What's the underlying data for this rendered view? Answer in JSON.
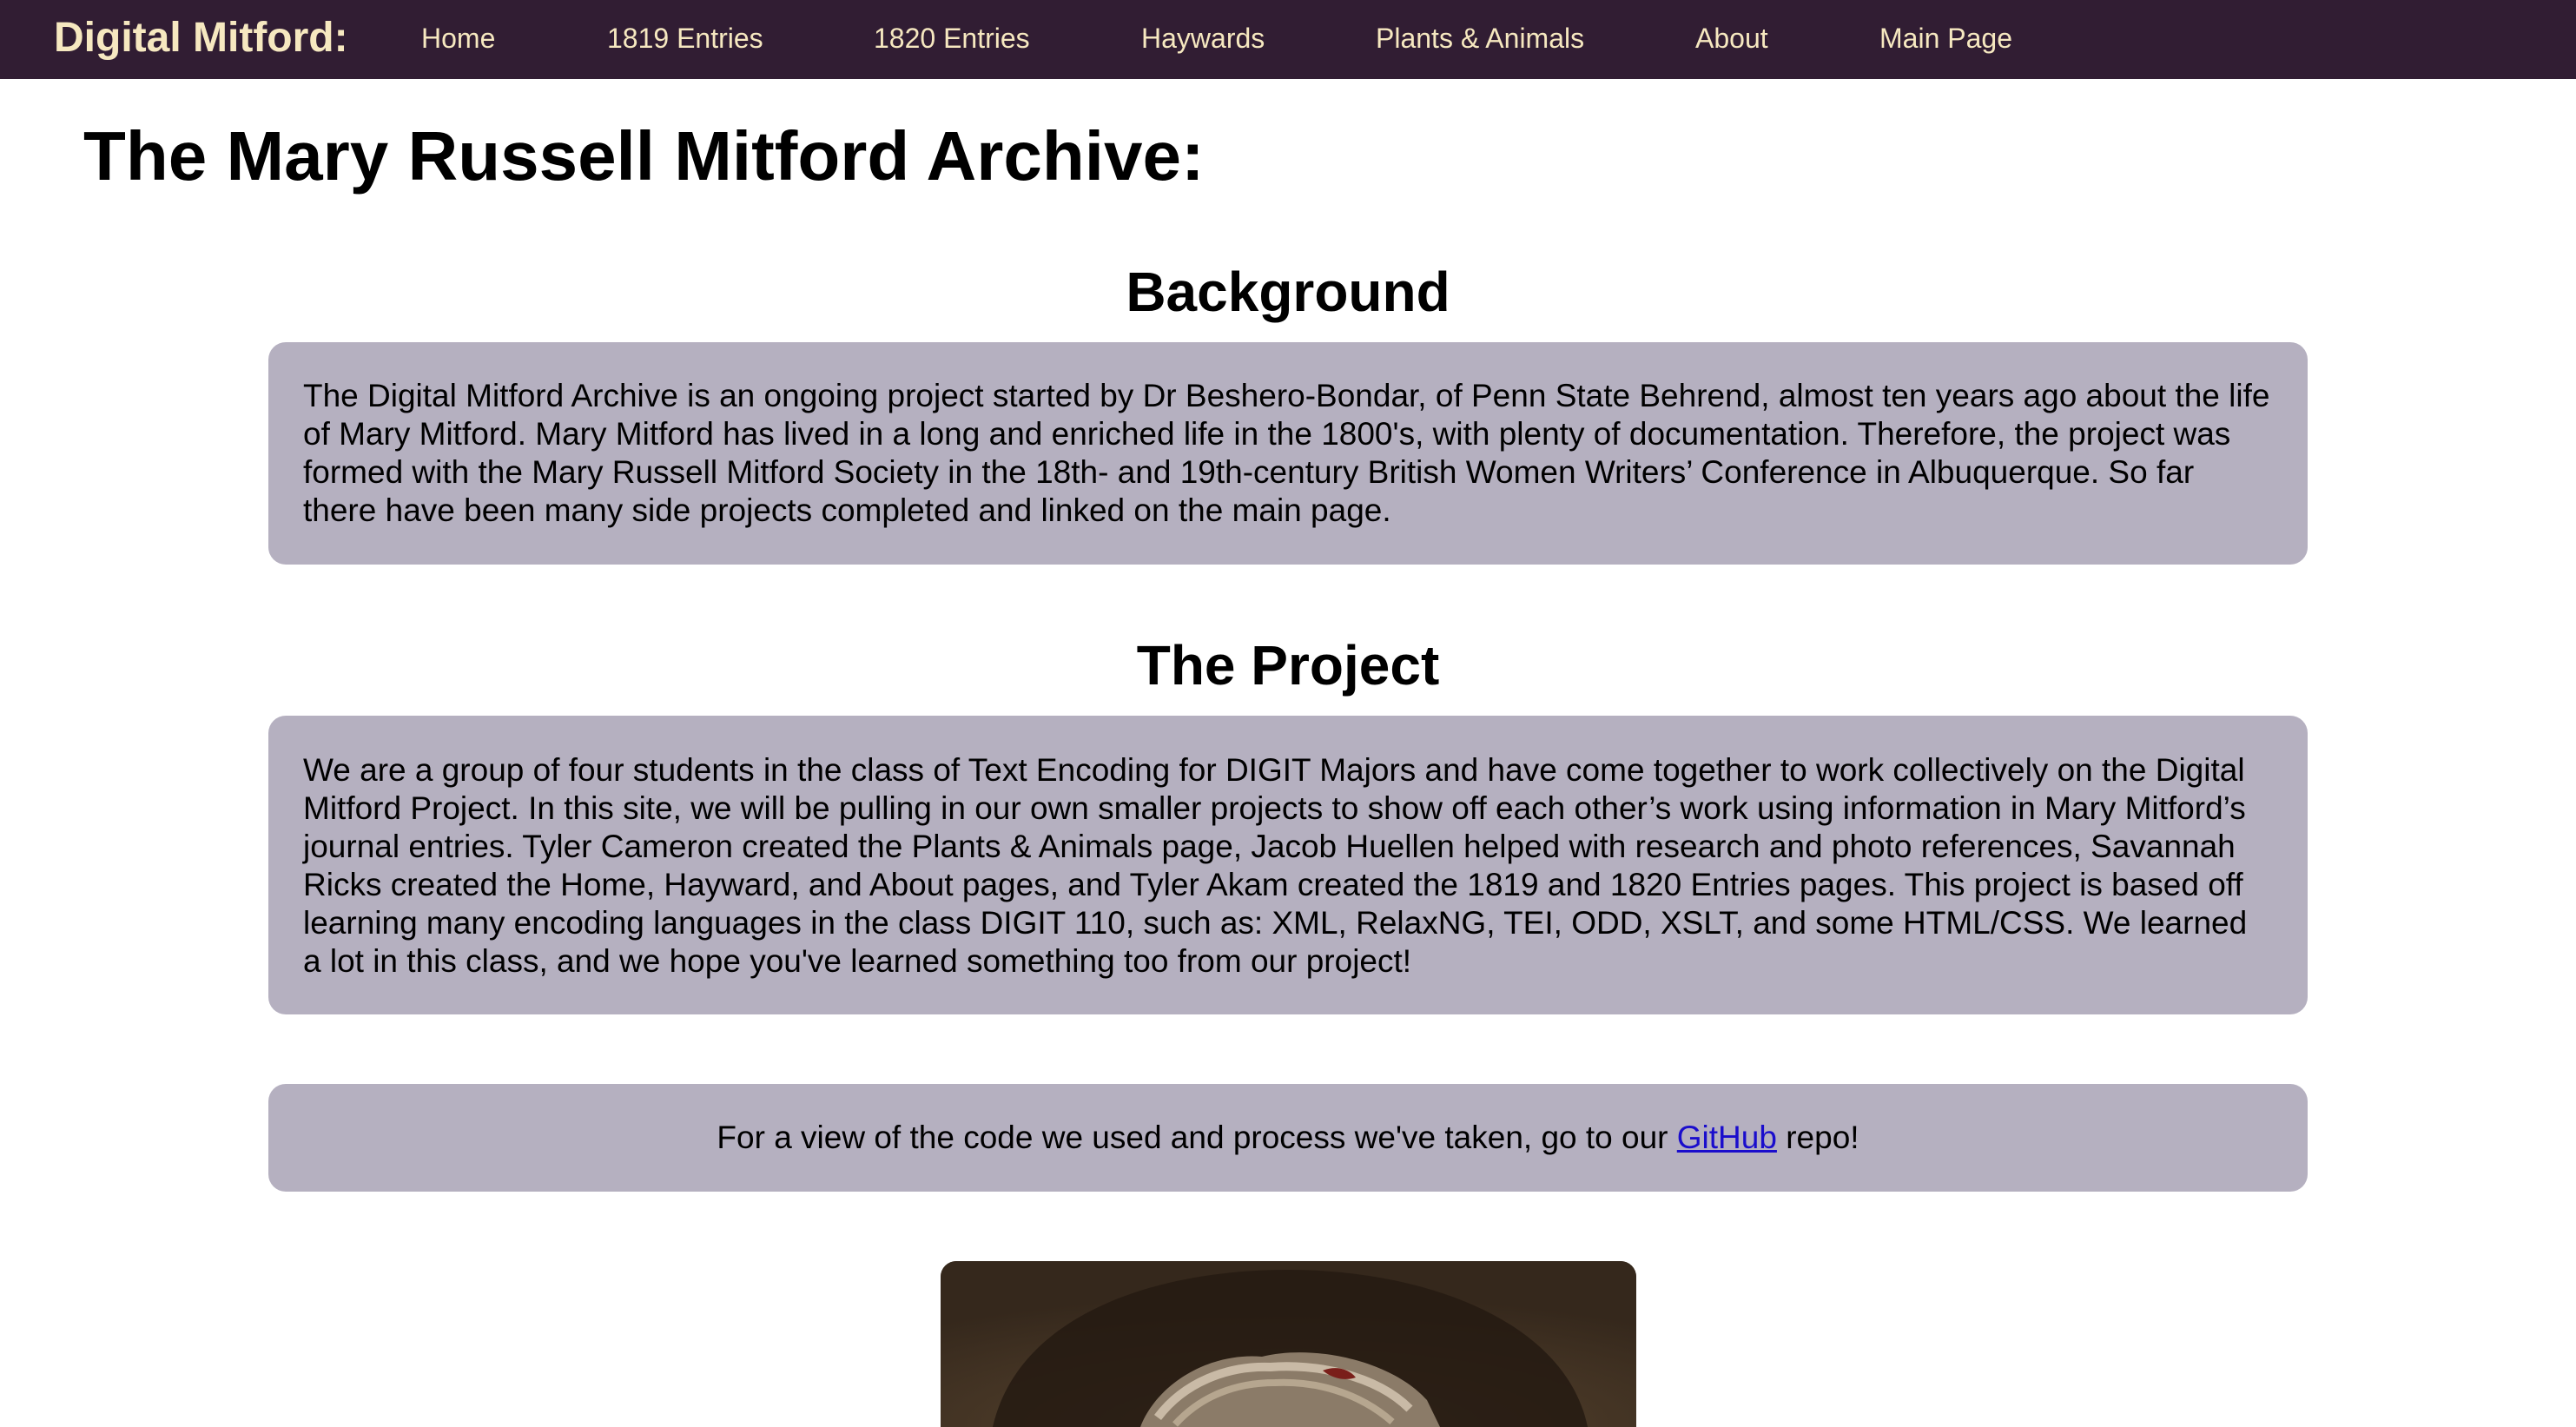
{
  "navbar": {
    "brand": "Digital Mitford:",
    "items": [
      {
        "label": "Home"
      },
      {
        "label": "1819 Entries"
      },
      {
        "label": "1820 Entries"
      },
      {
        "label": "Haywards"
      },
      {
        "label": "Plants & Animals"
      },
      {
        "label": "About"
      },
      {
        "label": "Main Page"
      }
    ]
  },
  "page": {
    "title": "The Mary Russell Mitford Archive:"
  },
  "sections": {
    "background": {
      "heading": "Background",
      "text": "The Digital Mitford Archive is an ongoing project started by Dr Beshero-Bondar, of Penn State Behrend, almost ten years ago about the life of Mary Mitford. Mary Mitford has lived in a long and enriched life in the 1800's, with plenty of documentation. Therefore, the project was formed with the Mary Russell Mitford Society in the 18th- and 19th-century British Women Writers’ Conference in Albuquerque. So far there have been many side projects completed and linked on the main page."
    },
    "project": {
      "heading": "The Project",
      "text": "We are a group of four students in the class of Text Encoding for DIGIT Majors and have come together to work collectively on the Digital Mitford Project. In this site, we will be pulling in our own smaller projects to show off each other’s work using information in Mary Mitford’s journal entries. Tyler Cameron created the Plants & Animals page, Jacob Huellen helped with research and photo references, Savannah Ricks created the Home, Hayward, and About pages, and Tyler Akam created the 1819 and 1820 Entries pages. This project is based off learning many encoding languages in the class DIGIT 110, such as: XML, RelaxNG, TEI, ODD, XSLT, and some HTML/CSS. We learned a lot in this class, and we hope you've learned something too from our project!"
    },
    "github": {
      "text_before": "For a view of the code we used and process we've taken, go to our ",
      "link_label": "GitHub",
      "text_after": " repo!"
    }
  },
  "colors": {
    "navbar_bg": "#311d33",
    "nav_text": "#f6e8c0",
    "card_bg": "#b5b0c0",
    "link": "#1a0dcc"
  }
}
